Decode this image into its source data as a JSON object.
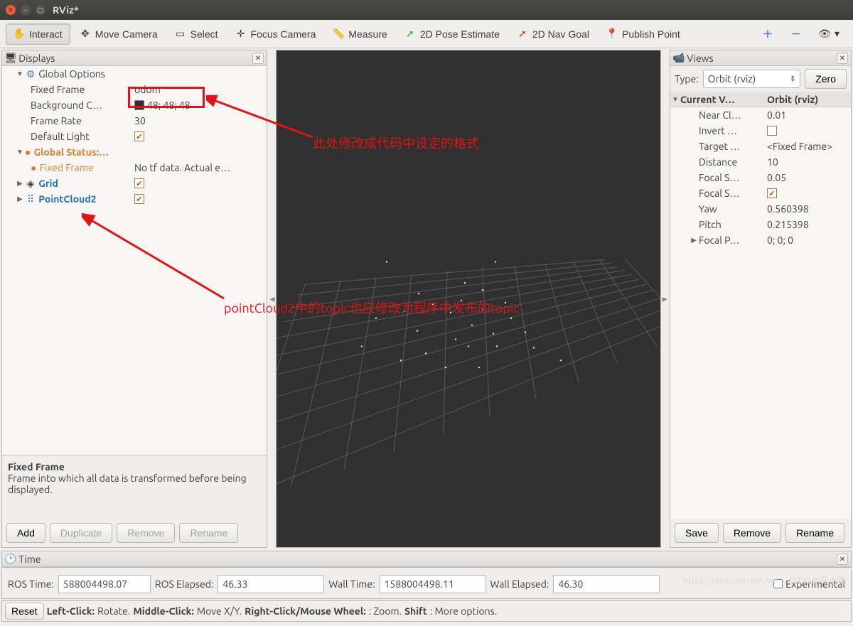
{
  "window": {
    "title": "RViz*"
  },
  "toolbar": {
    "interact": "Interact",
    "move_camera": "Move Camera",
    "select": "Select",
    "focus_camera": "Focus Camera",
    "measure": "Measure",
    "pose_estimate": "2D Pose Estimate",
    "nav_goal": "2D Nav Goal",
    "publish_point": "Publish Point"
  },
  "displays": {
    "title": "Displays",
    "global_options": {
      "label": "Global Options",
      "fixed_frame": {
        "label": "Fixed Frame",
        "value": "odom"
      },
      "background_color": {
        "label": "Background C…",
        "value": "48; 48; 48"
      },
      "frame_rate": {
        "label": "Frame Rate",
        "value": "30"
      },
      "default_light": {
        "label": "Default Light",
        "checked": true
      }
    },
    "global_status": {
      "label": "Global Status:…",
      "fixed_frame": {
        "label": "Fixed Frame",
        "value": "No tf data.  Actual e…"
      }
    },
    "grid": {
      "label": "Grid",
      "checked": true
    },
    "pointcloud2": {
      "label": "PointCloud2",
      "checked": true
    },
    "help": {
      "title": "Fixed Frame",
      "text": "Frame into which all data is transformed before being displayed."
    },
    "buttons": {
      "add": "Add",
      "duplicate": "Duplicate",
      "remove": "Remove",
      "rename": "Rename"
    }
  },
  "views": {
    "title": "Views",
    "type_label": "Type:",
    "type_value": "Orbit (rviz)",
    "zero": "Zero",
    "header": {
      "name": "Current V…",
      "value": "Orbit (rviz)"
    },
    "props": {
      "near_clip": {
        "label": "Near Cl…",
        "value": "0.01"
      },
      "invert_z": {
        "label": "Invert …",
        "checked": false
      },
      "target_frame": {
        "label": "Target …",
        "value": "<Fixed Frame>"
      },
      "distance": {
        "label": "Distance",
        "value": "10"
      },
      "focal_shape_size": {
        "label": "Focal S…",
        "value": "0.05"
      },
      "focal_shape_fixed": {
        "label": "Focal S…",
        "checked": true
      },
      "yaw": {
        "label": "Yaw",
        "value": "0.560398"
      },
      "pitch": {
        "label": "Pitch",
        "value": "0.215398"
      },
      "focal_point": {
        "label": "Focal P…",
        "value": "0; 0; 0"
      }
    },
    "buttons": {
      "save": "Save",
      "remove": "Remove",
      "rename": "Rename"
    }
  },
  "time": {
    "title": "Time",
    "ros_time_label": "ROS Time:",
    "ros_time": "588004498.07",
    "ros_elapsed_label": "ROS Elapsed:",
    "ros_elapsed": "46.33",
    "wall_time_label": "Wall Time:",
    "wall_time": "1588004498.11",
    "wall_elapsed_label": "Wall Elapsed:",
    "wall_elapsed": "46.30",
    "experimental": "Experimental"
  },
  "status": {
    "reset": "Reset",
    "left": "Left-Click:",
    "left_v": " Rotate. ",
    "middle": "Middle-Click:",
    "middle_v": " Move X/Y. ",
    "right": "Right-Click/Mouse Wheel:",
    "right_v": ": Zoom. ",
    "shift": "Shift",
    "shift_v": ": More options."
  },
  "annotations": {
    "a1": "此处修改成代码中设定的格式",
    "a2": "pointCloud2中的topic也应修改为程序中发布的topic"
  },
  "watermark": "https://blog.csdn.net/we… CSDN @马小乘"
}
